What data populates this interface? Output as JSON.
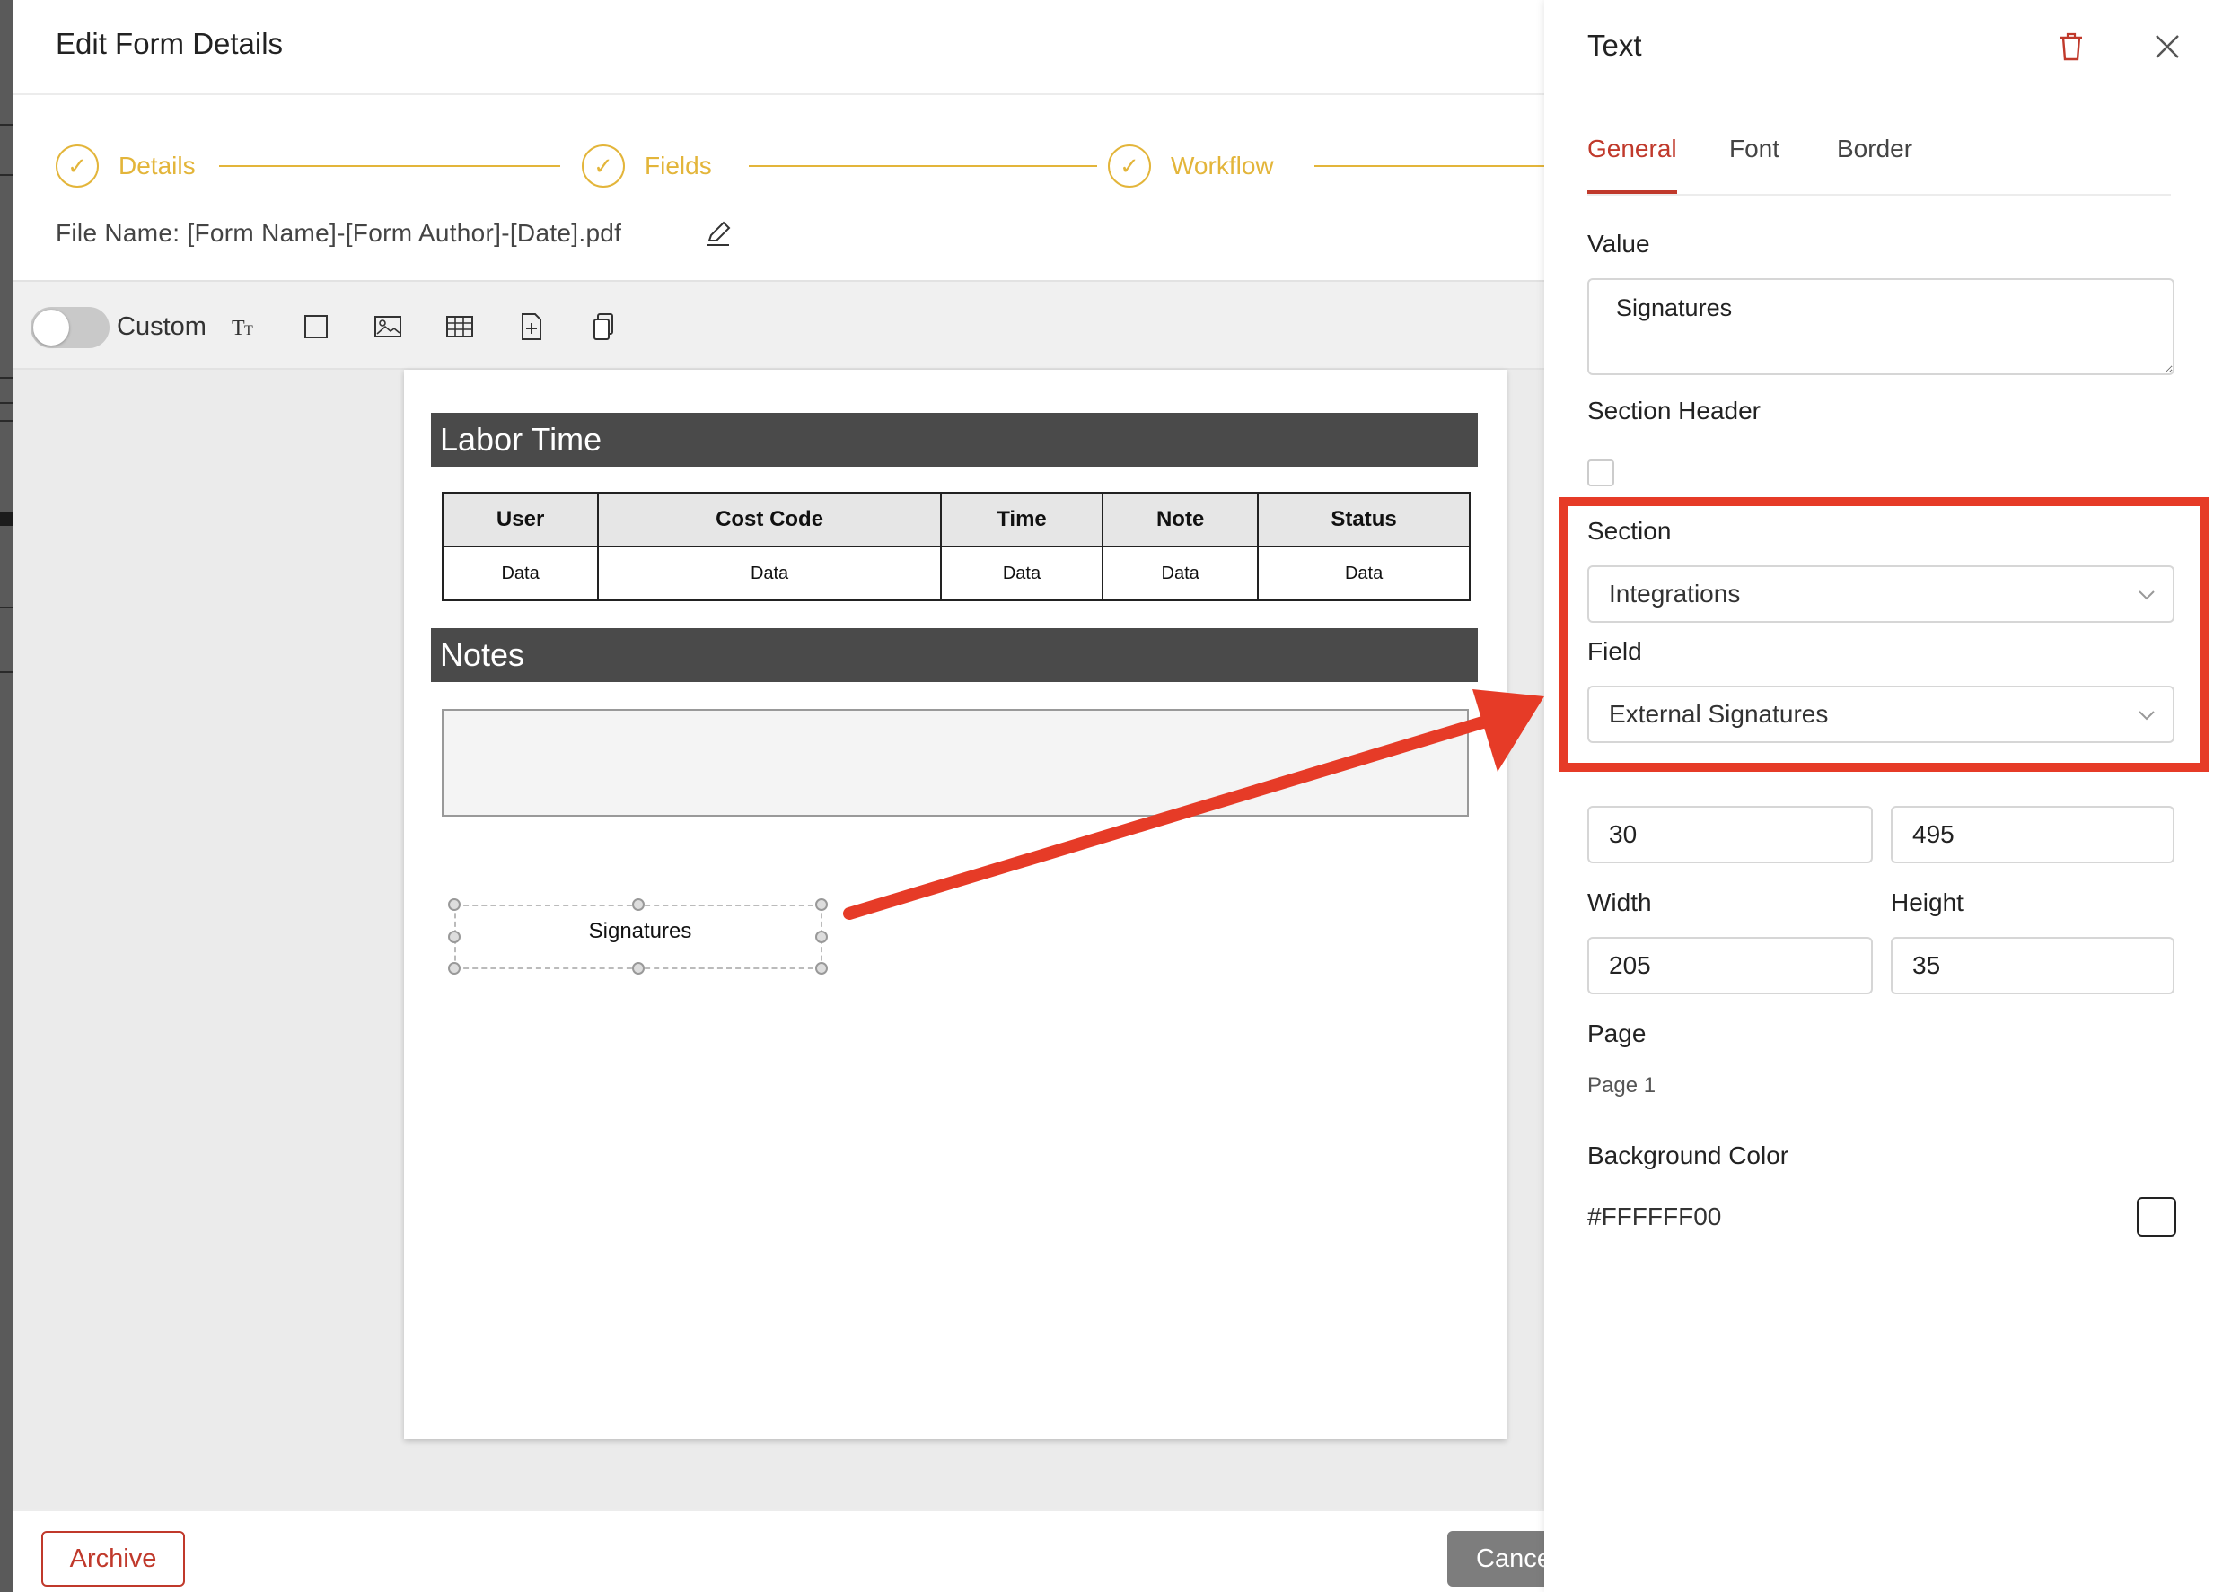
{
  "modal": {
    "title": "Edit Form Details",
    "steps": [
      {
        "label": "Details"
      },
      {
        "label": "Fields"
      },
      {
        "label": "Workflow"
      }
    ],
    "file_name": "File Name: [Form Name]-[Form Author]-[Date].pdf",
    "toolbar": {
      "custom_label": "Custom",
      "custom_toggle_on": false,
      "tools": [
        "text-tool-icon",
        "rectangle-tool-icon",
        "image-tool-icon",
        "table-tool-icon",
        "add-page-icon",
        "copy-page-icon"
      ]
    },
    "page": {
      "sections": [
        {
          "title": "Labor Time"
        },
        {
          "title": "Notes"
        }
      ],
      "table": {
        "headers": [
          "User",
          "Cost Code",
          "Time",
          "Note",
          "Status"
        ],
        "row": [
          "Data",
          "Data",
          "Data",
          "Data",
          "Data"
        ]
      },
      "selected_element_text": "Signatures"
    },
    "footer": {
      "archive_label": "Archive",
      "cancel_label": "Cance"
    }
  },
  "panel": {
    "title": "Text",
    "tabs": [
      {
        "label": "General",
        "active": true
      },
      {
        "label": "Font",
        "active": false
      },
      {
        "label": "Border",
        "active": false
      }
    ],
    "value_label": "Value",
    "value": "Signatures",
    "section_header_label": "Section Header",
    "section_header_checked": false,
    "section_label": "Section",
    "section_value": "Integrations",
    "field_label": "Field",
    "field_value": "External Signatures",
    "x_value": "30",
    "y_value": "495",
    "width_label": "Width",
    "width_value": "205",
    "height_label": "Height",
    "height_value": "35",
    "page_label": "Page",
    "page_value": "Page 1",
    "bg_label": "Background Color",
    "bg_value": "#FFFFFF00"
  },
  "colors": {
    "accent_gold": "#e3b53a",
    "accent_red": "#c0392b",
    "annotation_red": "#e63b27",
    "section_bar": "#4a4a4a"
  }
}
